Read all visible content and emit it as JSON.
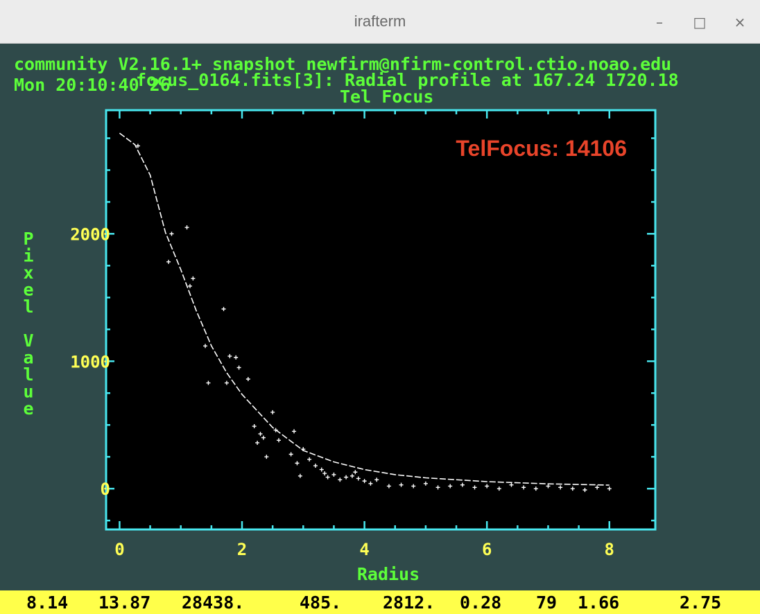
{
  "window": {
    "title": "irafterm",
    "minimize": "–",
    "maximize": "□",
    "close": "×"
  },
  "header": {
    "line1": "community V2.16.1+ snapshot newfirm@nfirm-control.ctio.noao.edu",
    "line2": "Mon 20:10:40 26",
    "line2_overlay": "focus_0164.fits[3]: Radial profile at 167.24 1720.18",
    "plot_title": "Tel Focus"
  },
  "annotation": "TelFocus: 14106",
  "colors": {
    "axis": "#48e6ee",
    "tick_label": "#ffff55",
    "axis_label": "#5dff3a",
    "annotation": "#e8442a",
    "data": "#ffffff",
    "status_bg": "#ffff4a",
    "terminal_bg": "#2f4a4a",
    "plot_bg": "#000000"
  },
  "chart_data": {
    "type": "scatter",
    "xlabel": "Radius",
    "ylabel": "Pixel Value",
    "xlim": [
      -0.22,
      8.75
    ],
    "ylim": [
      -320,
      2970
    ],
    "x_ticks": [
      0,
      2,
      4,
      6,
      8
    ],
    "y_ticks": [
      0,
      1000,
      2000
    ],
    "x_tick_labels": [
      "0",
      "2",
      "4",
      "6",
      "8"
    ],
    "y_tick_labels": [
      "0",
      "1000",
      "2000"
    ],
    "fit_curve": {
      "x": [
        0,
        0.25,
        0.5,
        0.75,
        1.0,
        1.25,
        1.5,
        1.75,
        2.0,
        2.5,
        3.0,
        3.5,
        4.0,
        4.5,
        5.0,
        6.0,
        7.0,
        8.0
      ],
      "y": [
        2790,
        2700,
        2460,
        2010,
        1720,
        1400,
        1120,
        910,
        740,
        480,
        300,
        210,
        150,
        110,
        85,
        55,
        38,
        28
      ]
    },
    "points": [
      [
        0.3,
        2690
      ],
      [
        0.8,
        1780
      ],
      [
        0.85,
        2000
      ],
      [
        1.1,
        2050
      ],
      [
        1.2,
        1650
      ],
      [
        1.15,
        1590
      ],
      [
        1.4,
        1120
      ],
      [
        1.45,
        830
      ],
      [
        1.7,
        1410
      ],
      [
        1.75,
        830
      ],
      [
        1.8,
        1040
      ],
      [
        1.9,
        1030
      ],
      [
        1.95,
        950
      ],
      [
        2.1,
        860
      ],
      [
        2.2,
        490
      ],
      [
        2.25,
        360
      ],
      [
        2.3,
        430
      ],
      [
        2.35,
        400
      ],
      [
        2.4,
        250
      ],
      [
        2.5,
        600
      ],
      [
        2.55,
        460
      ],
      [
        2.6,
        380
      ],
      [
        2.8,
        270
      ],
      [
        2.85,
        450
      ],
      [
        2.9,
        200
      ],
      [
        2.95,
        100
      ],
      [
        3.0,
        310
      ],
      [
        3.1,
        230
      ],
      [
        3.2,
        180
      ],
      [
        3.3,
        150
      ],
      [
        3.35,
        120
      ],
      [
        3.4,
        90
      ],
      [
        3.5,
        110
      ],
      [
        3.6,
        70
      ],
      [
        3.7,
        90
      ],
      [
        3.8,
        100
      ],
      [
        3.85,
        130
      ],
      [
        3.9,
        80
      ],
      [
        4.0,
        60
      ],
      [
        4.1,
        40
      ],
      [
        4.2,
        70
      ],
      [
        4.4,
        20
      ],
      [
        4.6,
        30
      ],
      [
        4.8,
        20
      ],
      [
        5.0,
        40
      ],
      [
        5.2,
        10
      ],
      [
        5.4,
        20
      ],
      [
        5.6,
        30
      ],
      [
        5.8,
        10
      ],
      [
        6.0,
        20
      ],
      [
        6.2,
        0
      ],
      [
        6.4,
        30
      ],
      [
        6.6,
        10
      ],
      [
        6.8,
        0
      ],
      [
        7.0,
        20
      ],
      [
        7.2,
        10
      ],
      [
        7.4,
        0
      ],
      [
        7.6,
        -10
      ],
      [
        7.8,
        10
      ],
      [
        8.0,
        0
      ]
    ]
  },
  "status_bar": [
    "8.14",
    "13.87",
    "28438.",
    "485.",
    "2812.",
    "0.28",
    "79",
    "1.66",
    "2.75"
  ]
}
